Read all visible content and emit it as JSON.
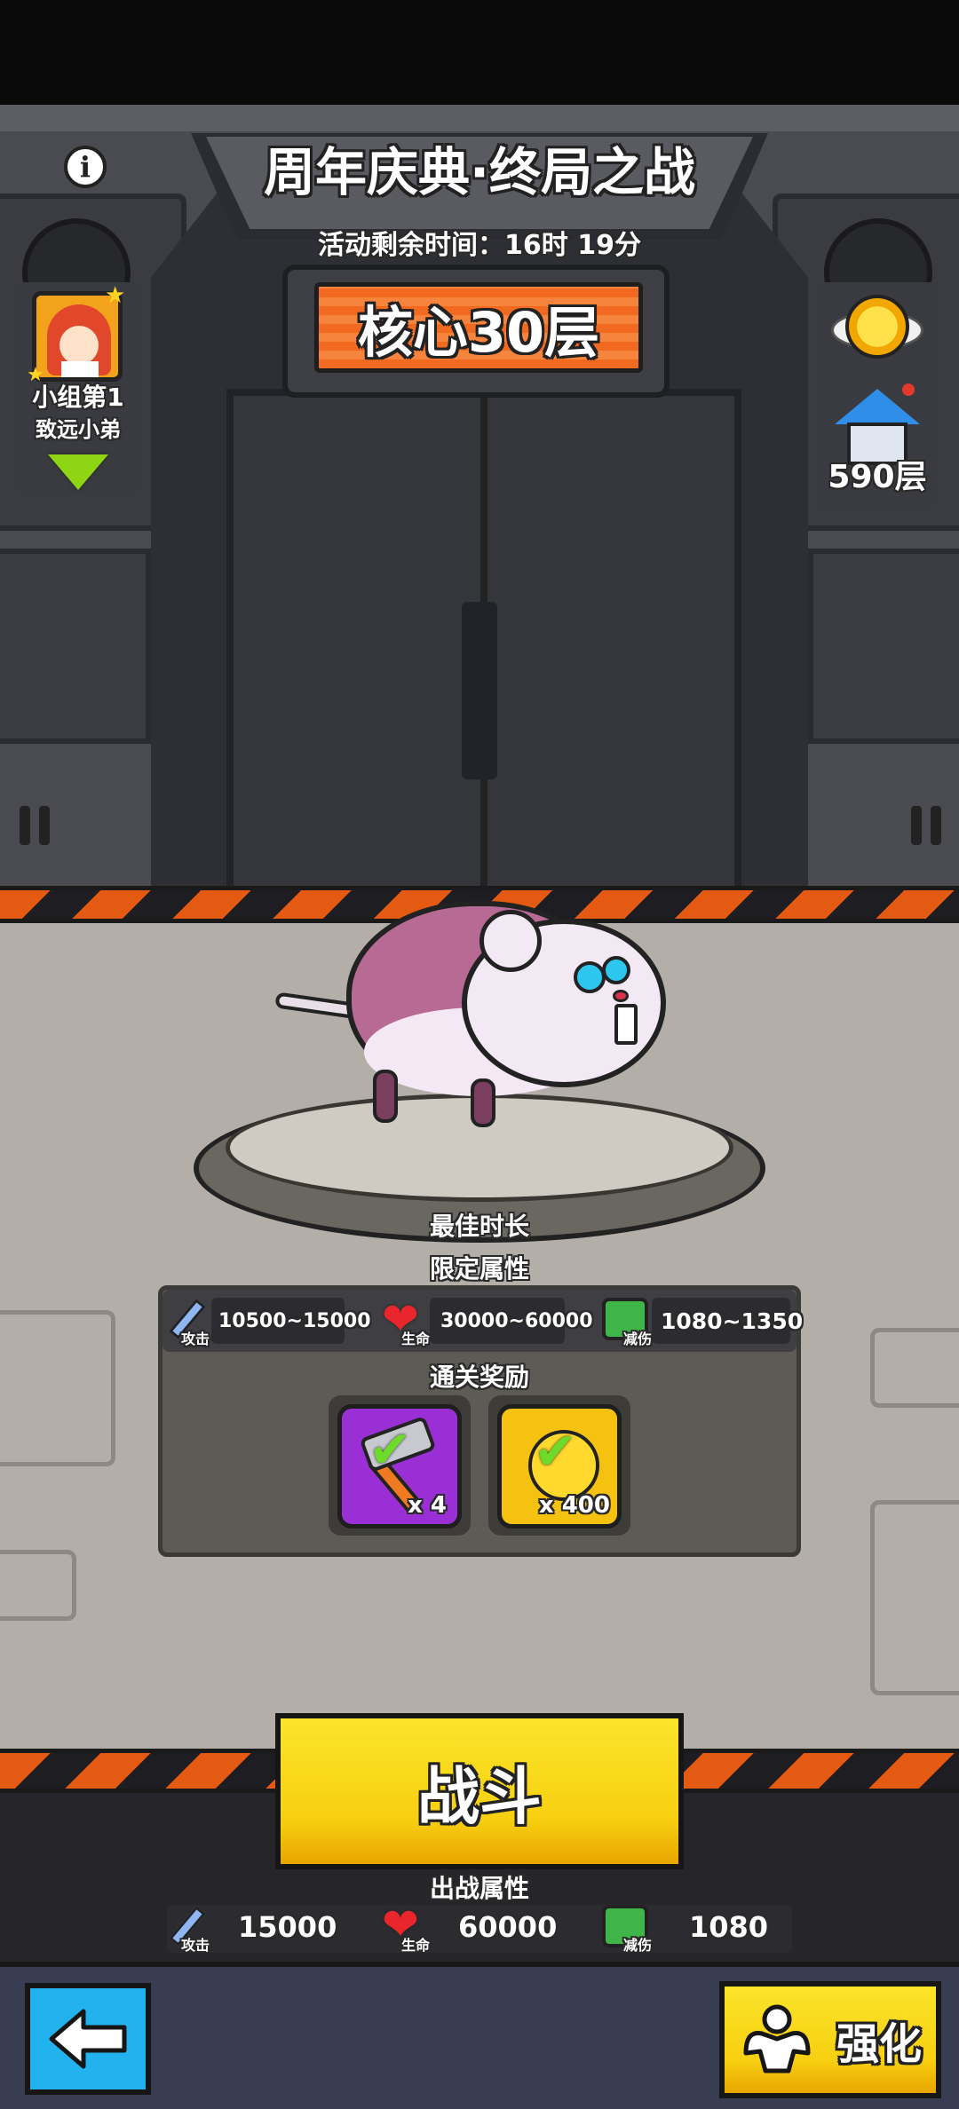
{
  "event": {
    "title": "周年庆典·终局之战",
    "time_remaining": "活动剩余时间：16时 19分",
    "stage_label": "核心30层"
  },
  "left_panel": {
    "rank_label": "小组第1",
    "player_name": "致远小弟"
  },
  "right_panel": {
    "floor_count": "590层"
  },
  "boss_info": {
    "best_time_label": "最佳时长",
    "limited_attr_label": "限定属性",
    "limited_stats": {
      "attack": "10500~15000",
      "attack_tag": "攻击",
      "hp": "30000~60000",
      "hp_tag": "生命",
      "defense": "1080~1350",
      "defense_tag": "减伤"
    },
    "reward_label": "通关奖励",
    "rewards": [
      {
        "name": "hammer",
        "count": "x 4",
        "color": "#9a2fd6"
      },
      {
        "name": "coin",
        "count": "x 400",
        "color": "#f5c210"
      }
    ]
  },
  "battle": {
    "button_label": "战斗",
    "deploy_attr_label": "出战属性",
    "stats": {
      "attack": "15000",
      "attack_tag": "攻击",
      "hp": "60000",
      "hp_tag": "生命",
      "defense": "1080",
      "defense_tag": "减伤"
    }
  },
  "nav": {
    "enhance_label": "强化"
  },
  "colors": {
    "stage_orange": "#f26a1f",
    "battle_yellow": "#f9d71c",
    "back_blue": "#22b2ee",
    "accent_hazard": "#e55a12"
  }
}
